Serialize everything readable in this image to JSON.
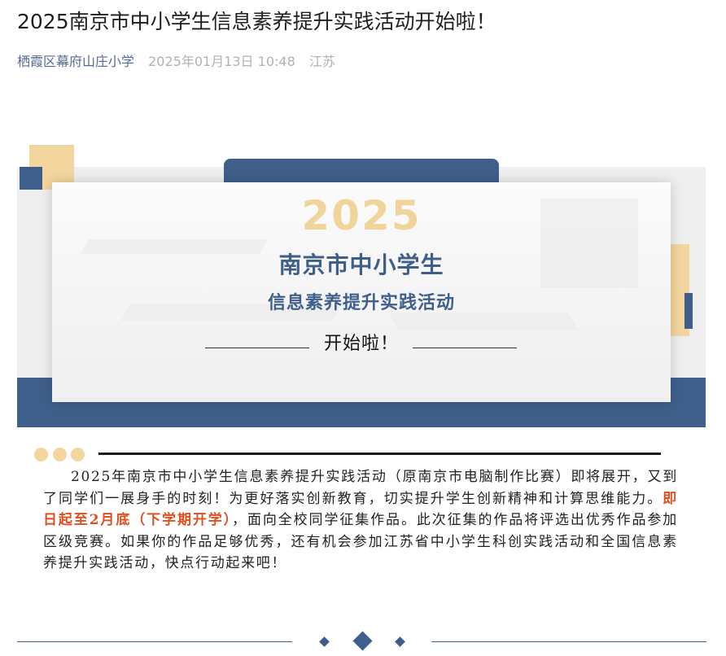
{
  "article": {
    "title": "2025南京市中小学生信息素养提升实践活动开始啦！",
    "author": "栖霞区幕府山庄小学",
    "datetime": "2025年01月13日 10:48",
    "location": "江苏"
  },
  "banner": {
    "year": "2025",
    "line1": "南京市中小学生",
    "line2": "信息素养提升实践活动",
    "line3": "开始啦！"
  },
  "body": {
    "text_before": "2025年南京市中小学生信息素养提升实践活动（原南京市电脑制作比赛）即将展开，又到了同学们一展身手的时刻！为更好落实创新教育，切实提升学生创新精神和计算思维能力。",
    "highlight": "即日起至2月底（下学期开学）",
    "text_after": "，面向全校同学征集作品。此次征集的作品将评选出优秀作品参加区级竞赛。如果你的作品足够优秀，还有机会参加江苏省中小学生科创实践活动和全国信息素养提升实践活动，快点行动起来吧！"
  },
  "colors": {
    "navy": "#3f5f8b",
    "gold": "#f3d59e",
    "highlight": "#e0501f",
    "author_link": "#576b95"
  }
}
